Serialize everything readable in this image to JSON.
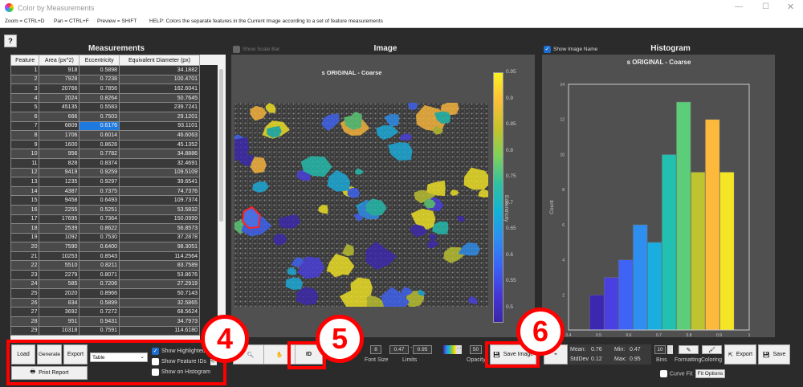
{
  "window": {
    "title": "Color by Measurements"
  },
  "help": {
    "zoom": "Zoom = CTRL+D",
    "pan": "Pan = CTRL+F",
    "preview": "Preview = SHIFT",
    "help": "HELP:  Colors the separate features in the Current Image according to a set of feature measurements"
  },
  "help_button": "?",
  "measurements": {
    "title": "Measurements",
    "columns": [
      "Feature",
      "Area (px^2)",
      "Eccentricity",
      "Equivalent Diameter (px)"
    ],
    "rows": [
      [
        "1",
        "918",
        "0.5898",
        "34.1882"
      ],
      [
        "2",
        "7928",
        "0.7238",
        "100.4701"
      ],
      [
        "3",
        "20766",
        "0.7856",
        "162.6041"
      ],
      [
        "4",
        "2024",
        "0.8264",
        "50.7645"
      ],
      [
        "5",
        "45135",
        "0.5583",
        "239.7241"
      ],
      [
        "6",
        "666",
        "0.7503",
        "29.1201"
      ],
      [
        "7",
        "6809",
        "0.6176",
        "93.1101"
      ],
      [
        "8",
        "1706",
        "0.6014",
        "46.6063"
      ],
      [
        "9",
        "1600",
        "0.8628",
        "45.1352"
      ],
      [
        "10",
        "956",
        "0.7782",
        "34.8886"
      ],
      [
        "11",
        "828",
        "0.8374",
        "32.4691"
      ],
      [
        "12",
        "9419",
        "0.9259",
        "109.5109"
      ],
      [
        "13",
        "1235",
        "0.9297",
        "39.6541"
      ],
      [
        "14",
        "4387",
        "0.7375",
        "74.7376"
      ],
      [
        "15",
        "9458",
        "0.6493",
        "109.7374"
      ],
      [
        "16",
        "2255",
        "0.5251",
        "53.5832"
      ],
      [
        "17",
        "17695",
        "0.7364",
        "150.0999"
      ],
      [
        "18",
        "2539",
        "0.8622",
        "56.8573"
      ],
      [
        "19",
        "1092",
        "0.7530",
        "37.2878"
      ],
      [
        "20",
        "7590",
        "0.6400",
        "98.3051"
      ],
      [
        "21",
        "10253",
        "0.8543",
        "114.2564"
      ],
      [
        "22",
        "5510",
        "0.8211",
        "83.7589"
      ],
      [
        "23",
        "2279",
        "0.8071",
        "53.8676"
      ],
      [
        "24",
        "585",
        "0.7206",
        "27.2919"
      ],
      [
        "25",
        "2020",
        "0.8966",
        "50.7143"
      ],
      [
        "26",
        "834",
        "0.5899",
        "32.5865"
      ],
      [
        "27",
        "3692",
        "0.7272",
        "68.5624"
      ],
      [
        "28",
        "951",
        "0.9431",
        "34.7973"
      ],
      [
        "29",
        "10318",
        "0.7591",
        "114.6180"
      ]
    ],
    "selected_row": 6,
    "selected_col": 2,
    "buttons": {
      "load": "Load",
      "generate": "Generate",
      "export": "Export",
      "print": "Print Report"
    },
    "mode_select": "Table",
    "checks": [
      {
        "label": "Show Highlighted",
        "checked": true
      },
      {
        "label": "Show Feature IDs",
        "checked": false
      },
      {
        "label": "Show on Histogram",
        "checked": false
      }
    ]
  },
  "image": {
    "title": "Image",
    "show_scale_bar": "Show Scale Bar",
    "image_name": "s ORIGINAL - Coarse",
    "colorbar_label": "Eccentricity",
    "colorbar_ticks": [
      "0.95",
      "0.9",
      "0.85",
      "0.8",
      "0.75",
      "0.7",
      "0.65",
      "0.6",
      "0.55",
      "0.5"
    ],
    "id_button": "ID",
    "font_size": "8",
    "font_size_label": "Font Size",
    "limit_min": "0.47",
    "limit_sep": "-",
    "limit_max": "0.95",
    "limits_label": "Limits",
    "opacity": "50",
    "opacity_label": "Opacity",
    "save_image": "Save Image"
  },
  "histogram": {
    "title": "Histogram",
    "show_image_name": "Show Image Name",
    "stats": {
      "mean_label": "Mean:",
      "mean": "0.76",
      "min_label": "Min:",
      "min": "0.47",
      "std_label": "StdDev",
      "std": "0.12",
      "max_label": "Max:",
      "max": "0.95"
    },
    "bins": "10",
    "bins_label": "Bins",
    "formatting": "Formatting",
    "coloring": "Coloring",
    "export": "Export",
    "save": "Save",
    "curve_fit": "Curve Fit",
    "fit_options": "Fit Options"
  },
  "callouts": [
    "4",
    "5",
    "6"
  ],
  "chart_data": {
    "type": "bar",
    "title": "s ORIGINAL - Coarse",
    "xlabel": "Eccentricity",
    "ylabel": "Count",
    "xlim": [
      0.4,
      1
    ],
    "ylim": [
      0,
      14
    ],
    "xticks": [
      "0.4",
      "0.5",
      "0.6",
      "0.7",
      "0.8",
      "0.9",
      "1"
    ],
    "yticks": [
      "2",
      "4",
      "6",
      "8",
      "10",
      "12",
      "14"
    ],
    "bin_edges": [
      0.47,
      0.518,
      0.566,
      0.614,
      0.662,
      0.71,
      0.758,
      0.806,
      0.854,
      0.902,
      0.95
    ],
    "values": [
      2,
      3,
      4,
      6,
      5,
      10,
      13,
      9,
      12,
      9
    ],
    "colors": [
      "#3c28b0",
      "#4a3fe0",
      "#3f63f5",
      "#2e8ff0",
      "#1aaede",
      "#22c0b0",
      "#5ccd78",
      "#bec430",
      "#fdb93c",
      "#f4e624"
    ]
  }
}
